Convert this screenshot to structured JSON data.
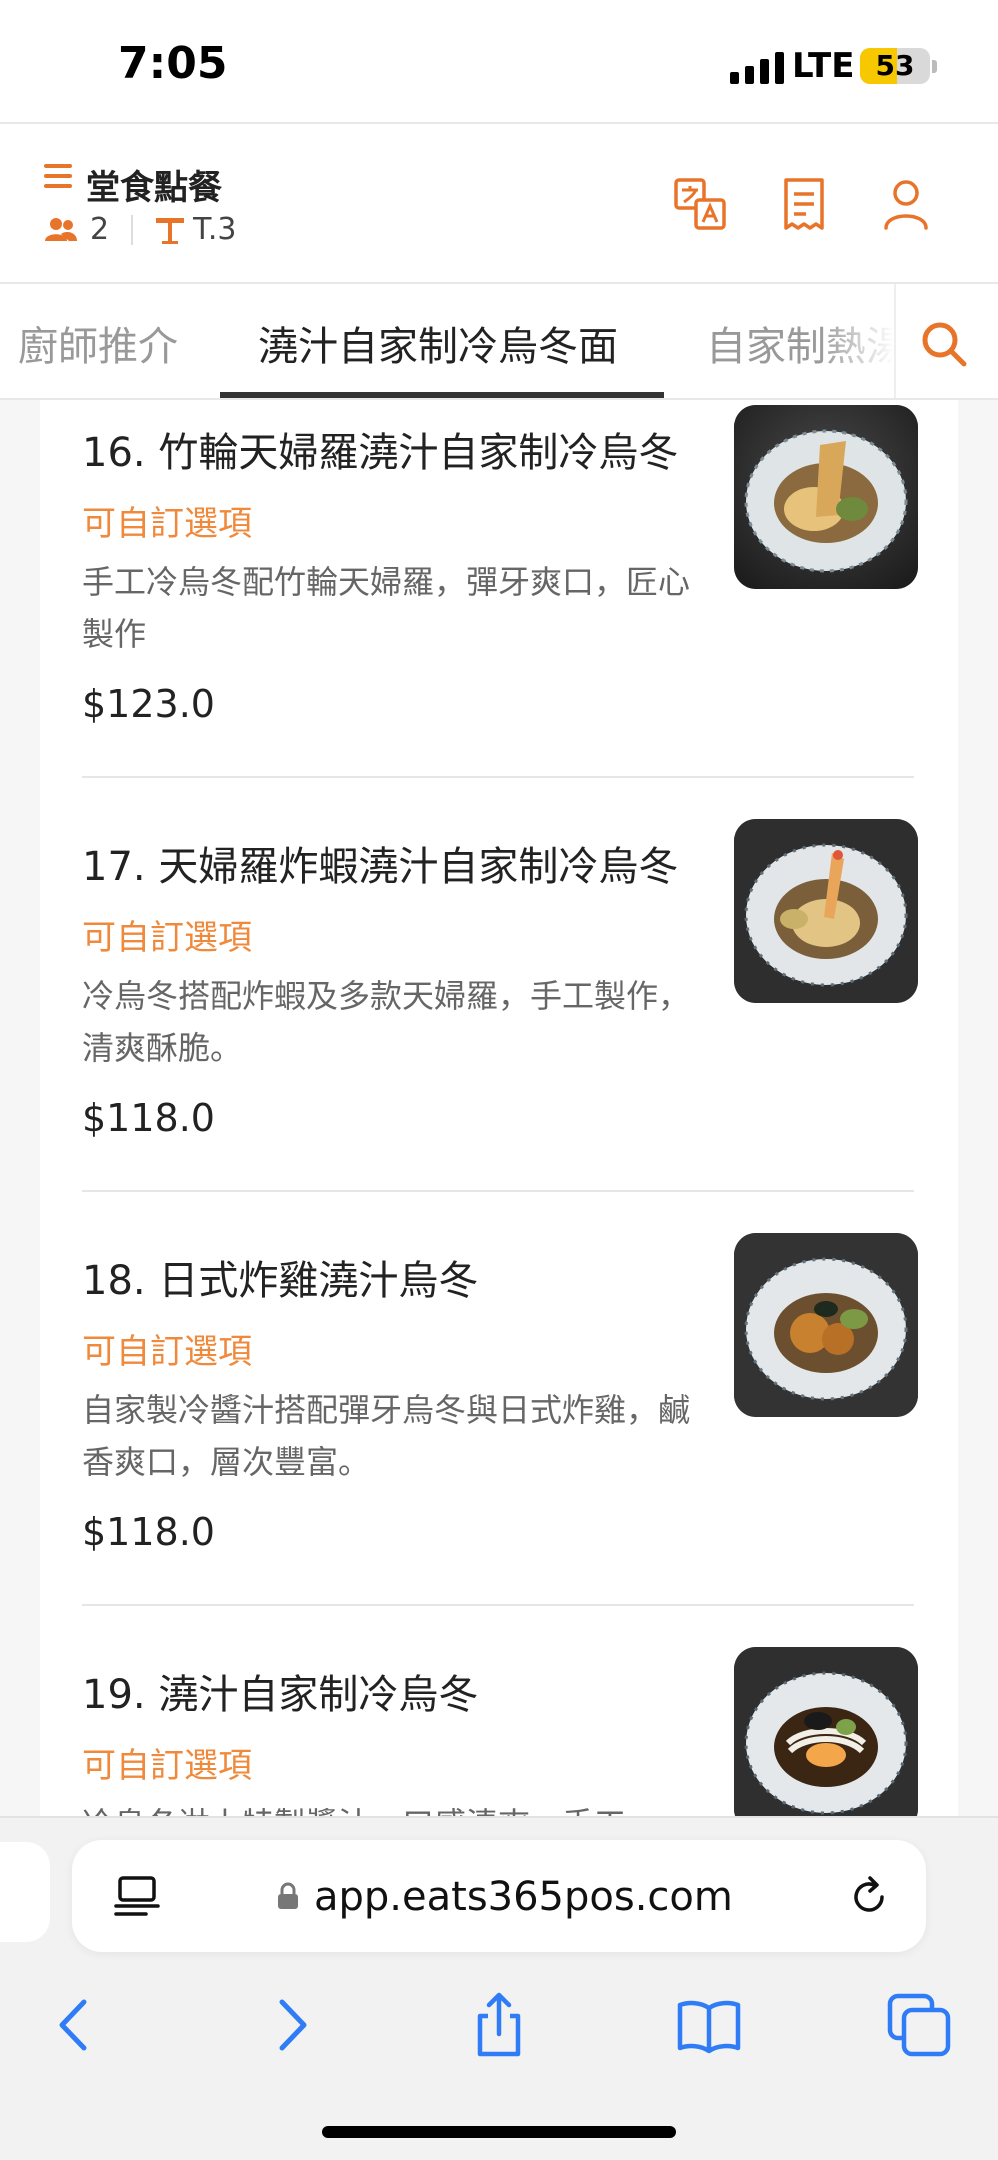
{
  "status_bar": {
    "time": "7:05",
    "network": "LTE",
    "battery": "53",
    "battery_level": 0.53
  },
  "header": {
    "title": "堂食點餐",
    "guests": "2",
    "table": "T.3"
  },
  "tabs": [
    {
      "label": "廚師推介",
      "active": false
    },
    {
      "label": "澆汁自家制冷烏冬面",
      "active": true
    },
    {
      "label": "自家制熱湯",
      "active": false
    }
  ],
  "items": [
    {
      "name": "16. 竹輪天婦羅澆汁自家制冷烏冬",
      "option": "可自訂選項",
      "desc": "手工冷烏冬配竹輪天婦羅，彈牙爽口，匠心製作",
      "price": "$123.0"
    },
    {
      "name": "17. 天婦羅炸蝦澆汁自家制冷烏冬",
      "option": "可自訂選項",
      "desc": "冷烏冬搭配炸蝦及多款天婦羅，手工製作，清爽酥脆。",
      "price": "$118.0"
    },
    {
      "name": "18. 日式炸雞澆汁烏冬",
      "option": "可自訂選項",
      "desc": "自家製冷醬汁搭配彈牙烏冬與日式炸雞，鹹香爽口，層次豐富。",
      "price": "$118.0"
    },
    {
      "name": "19. 澆汁自家制冷烏冬",
      "option": "可自訂選項",
      "desc": "冷烏冬淋上特製醬汁，口感清爽，手工",
      "price": ""
    }
  ],
  "browser": {
    "url": "app.eats365pos.com"
  },
  "colors": {
    "accent": "#e8742a",
    "option_text": "#ef8a3c",
    "ios_blue": "#2f7cf6"
  }
}
